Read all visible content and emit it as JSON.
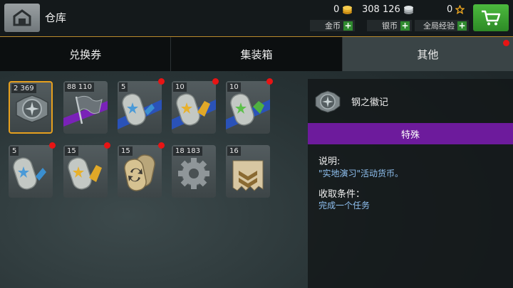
{
  "header": {
    "title": "仓库",
    "gold": {
      "value": "0",
      "label": "金币"
    },
    "silver": {
      "value": "308 126",
      "label": "银币"
    },
    "exp": {
      "value": "0",
      "label": "全局经验"
    },
    "plus": "+"
  },
  "tabs": [
    {
      "label": "兑换券"
    },
    {
      "label": "集装箱"
    },
    {
      "label": "其他"
    }
  ],
  "items": [
    {
      "count": "2 369",
      "icon": "steel-emblem-icon"
    },
    {
      "count": "88 110",
      "icon": "flag-icon"
    },
    {
      "count": "5",
      "icon": "blue-star-dogtag-icon"
    },
    {
      "count": "10",
      "icon": "gold-star-dogtag-icon"
    },
    {
      "count": "10",
      "icon": "green-star-dogtag-icon"
    },
    {
      "count": "5",
      "icon": "blue-dogtag-icon"
    },
    {
      "count": "15",
      "icon": "gold-dogtag-icon"
    },
    {
      "count": "15",
      "icon": "refresh-dogtag-icon"
    },
    {
      "count": "18 183",
      "icon": "gear-icon"
    },
    {
      "count": "16",
      "icon": "rank-chevron-icon"
    }
  ],
  "detail": {
    "name": "钢之徽记",
    "rarity": "特殊",
    "desc_title": "说明:",
    "desc_text": "\"实地演习\"活动货币。",
    "cond_title": "收取条件：",
    "cond_text": "完成一个任务"
  },
  "colors": {
    "accent": "#e6a01e",
    "rarity_band": "#6d1b9c",
    "link_text": "#8fc0f0",
    "badge": "#e81414",
    "shop": "#3ea833"
  }
}
